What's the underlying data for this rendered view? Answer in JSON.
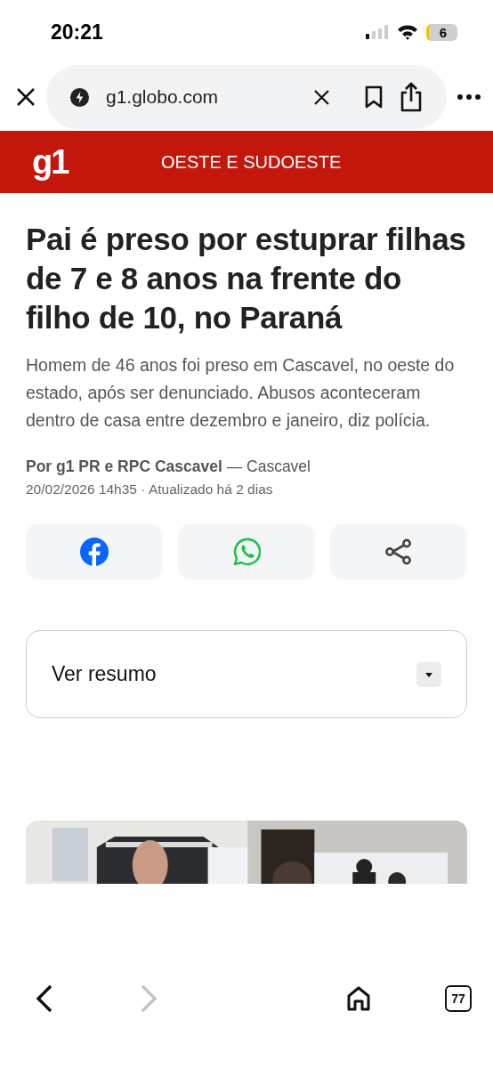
{
  "status_bar": {
    "time": "20:21",
    "battery": "6"
  },
  "browser": {
    "url": "g1.globo.com",
    "tab_count": "77",
    "back_disabled": false,
    "forward_disabled": true
  },
  "site_header": {
    "logo": "g1",
    "section": "OESTE E SUDOESTE"
  },
  "article": {
    "title": "Pai é preso por estuprar filhas de 7 e 8 anos na frente do filho de 10, no Paraná",
    "subtitle": "Homem de 46 anos foi preso em Cascavel, no oeste do estado, após ser denunciado. Abusos aconteceram dentro de casa entre dezembro e janeiro, diz polícia.",
    "byline": "**Por g1 PR e RPC Cascavel** — Cascavel",
    "date": "20/02/2026 14h35 · Atualizado há 2 dias",
    "share_buttons": [
      {
        "kind": "facebook"
      },
      {
        "kind": "whatsapp"
      },
      {
        "kind": "share"
      }
    ],
    "summary": {
      "label": "Ver resumo",
      "expanded": false
    }
  }
}
